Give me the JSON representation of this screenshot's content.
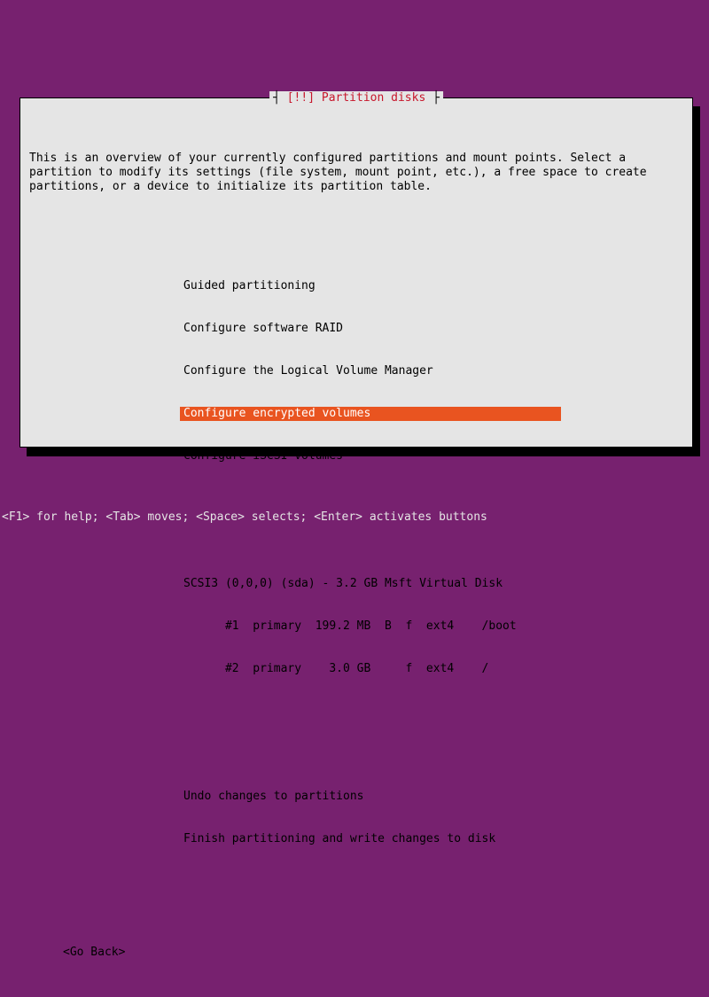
{
  "dialog": {
    "title_prefix": "[!!] ",
    "title_text": "Partition disks",
    "intro": "This is an overview of your currently configured partitions and mount points. Select a\npartition to modify its settings (file system, mount point, etc.), a free space to create\npartitions, or a device to initialize its partition table.",
    "menu": [
      "Guided partitioning",
      "Configure software RAID",
      "Configure the Logical Volume Manager",
      "Configure encrypted volumes",
      "Configure iSCSI volumes"
    ],
    "selected_index": 3,
    "disk_header": "SCSI3 (0,0,0) (sda) - 3.2 GB Msft Virtual Disk",
    "partitions": [
      "      #1  primary  199.2 MB  B  f  ext4    /boot",
      "      #2  primary    3.0 GB     f  ext4    /"
    ],
    "actions": [
      "Undo changes to partitions",
      "Finish partitioning and write changes to disk"
    ],
    "go_back": "<Go Back>"
  },
  "helpbar": "<F1> for help; <Tab> moves; <Space> selects; <Enter> activates buttons"
}
